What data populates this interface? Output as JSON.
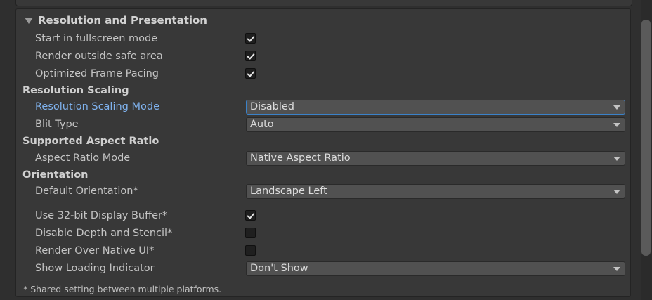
{
  "section": {
    "title": "Resolution and Presentation",
    "collapse_icon": "triangle-down-icon"
  },
  "rows": {
    "fullscreen": {
      "label": "Start in fullscreen mode",
      "checked": true
    },
    "safe_area": {
      "label": "Render outside safe area",
      "checked": true
    },
    "frame_pacing": {
      "label": "Optimized Frame Pacing",
      "checked": true
    },
    "scaling_mode": {
      "label": "Resolution Scaling Mode",
      "value": "Disabled"
    },
    "blit_type": {
      "label": "Blit Type",
      "value": "Auto"
    },
    "aspect_mode": {
      "label": "Aspect Ratio Mode",
      "value": "Native Aspect Ratio"
    },
    "orientation": {
      "label": "Default Orientation*",
      "value": "Landscape Left"
    },
    "display_buffer": {
      "label": "Use 32-bit Display Buffer*",
      "checked": true
    },
    "depth_stencil": {
      "label": "Disable Depth and Stencil*",
      "checked": false
    },
    "native_ui": {
      "label": "Render Over Native UI*",
      "checked": false
    },
    "loading_indicator": {
      "label": "Show Loading Indicator",
      "value": "Don't Show"
    }
  },
  "headers": {
    "resolution_scaling": "Resolution Scaling",
    "aspect_ratio": "Supported Aspect Ratio",
    "orientation": "Orientation"
  },
  "footnote": "* Shared setting between multiple platforms.",
  "colors": {
    "background": "#383838",
    "label": "#c4c4c4",
    "active_label": "#7fb2ee",
    "focus_border": "#3b82c9",
    "dropdown": "#515151"
  }
}
